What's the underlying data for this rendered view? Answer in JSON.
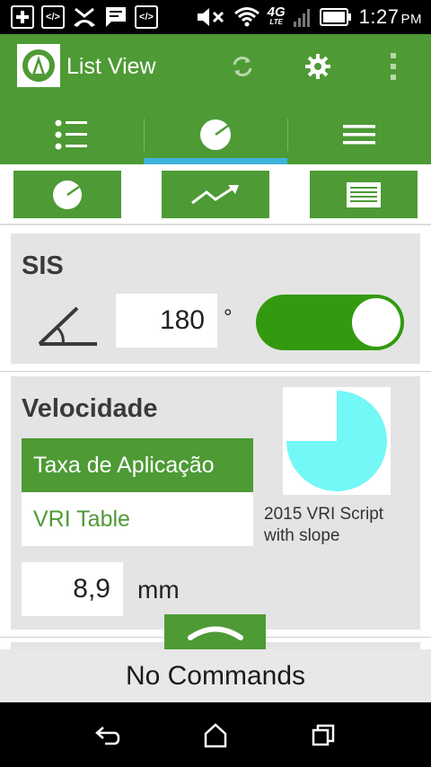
{
  "status_bar": {
    "left_icons": [
      "plus-icon",
      "code-icon",
      "missed-call-icon",
      "message-icon",
      "code-icon"
    ],
    "network": "4G",
    "network_sub": "LTE",
    "time": "1:27",
    "ampm": "PM"
  },
  "app_bar": {
    "title": "List View",
    "actions": [
      "refresh-icon",
      "gear-icon",
      "overflow-menu-icon"
    ]
  },
  "tabs": [
    {
      "icon": "list-icon",
      "active": false
    },
    {
      "icon": "pie-icon",
      "active": true
    },
    {
      "icon": "menu-icon",
      "active": false
    }
  ],
  "sub_toolbar": [
    "pie-icon",
    "trend-icon",
    "table-icon"
  ],
  "sis": {
    "title": "SIS",
    "angle_value": "180",
    "unit": "°",
    "toggle_on": true
  },
  "velocidade": {
    "title": "Velocidade",
    "options": [
      {
        "label": "Taxa de Aplicação",
        "selected": true
      },
      {
        "label": "VRI Table",
        "selected": false
      }
    ],
    "script_caption": "2015 VRI Script with slope",
    "pie_fraction": 0.75,
    "value": "8,9",
    "unit": "mm"
  },
  "command_bar": {
    "label": "No Commands"
  },
  "colors": {
    "primary": "#4e9a35",
    "toggle": "#339a0f",
    "tab_indicator": "#3fb3d9",
    "pie": "#73f7f7",
    "card": "#e4e4e4"
  }
}
